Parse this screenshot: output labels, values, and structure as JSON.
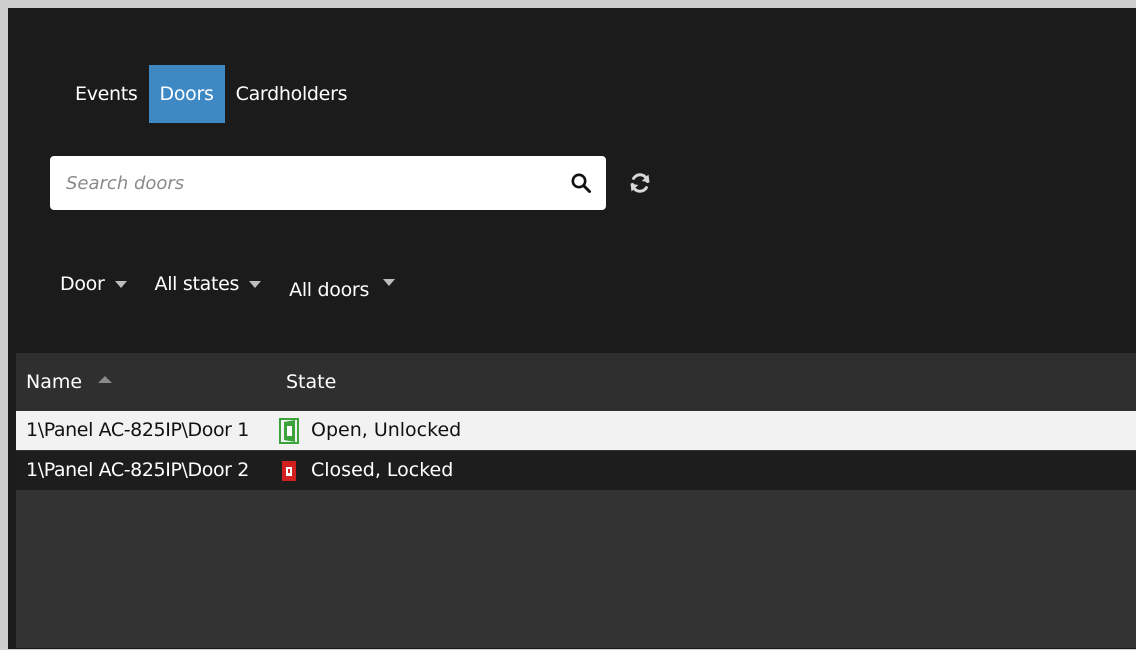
{
  "tabs": [
    {
      "label": "Events",
      "active": false
    },
    {
      "label": "Doors",
      "active": true
    },
    {
      "label": "Cardholders",
      "active": false
    }
  ],
  "search": {
    "placeholder": "Search doors",
    "value": ""
  },
  "icons": {
    "search": "search-icon",
    "refresh": "refresh-icon",
    "sort": "sort-ascending-icon",
    "door_open": "door-open-icon",
    "door_closed": "door-closed-icon"
  },
  "filters": [
    {
      "label": "Door"
    },
    {
      "label": "All states"
    },
    {
      "label": "All doors"
    }
  ],
  "table": {
    "columns": [
      {
        "label": "Name",
        "sorted": "ascending"
      },
      {
        "label": "State"
      }
    ],
    "rows": [
      {
        "name": "1\\Panel AC-825IP\\Door 1",
        "state": "Open, Unlocked",
        "status": "open",
        "selected": true
      },
      {
        "name": "1\\Panel AC-825IP\\Door 2",
        "state": "Closed, Locked",
        "status": "closed",
        "selected": false
      }
    ]
  },
  "colors": {
    "background": "#1b1b1b",
    "active_tab": "#3e88c4",
    "open_door": "#3aa33a",
    "closed_door": "#d21f1f"
  }
}
